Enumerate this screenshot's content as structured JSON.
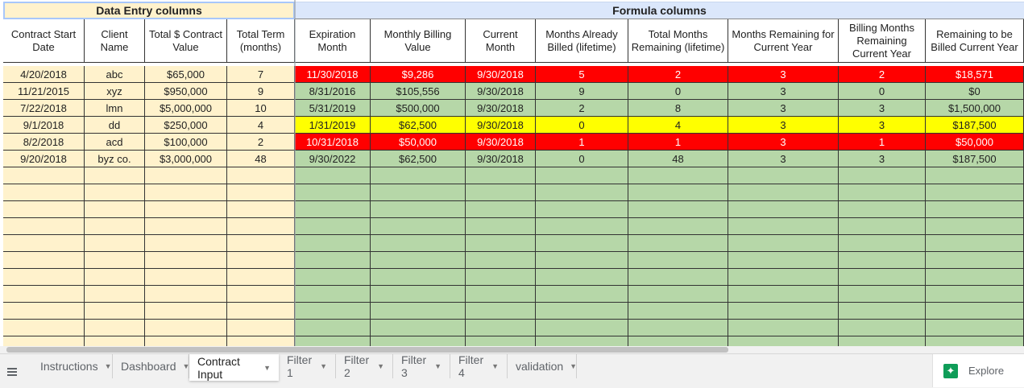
{
  "section_headers": {
    "data_entry": "Data Entry columns",
    "formula": "Formula columns"
  },
  "column_headers": [
    "Contract Start Date",
    "Client Name",
    "Total $ Contract Value",
    "Total Term (months)",
    "Expiration Month",
    "Monthly Billing Value",
    "Current Month",
    "Months Already Billed (lifetime)",
    "Total Months Remaining (lifetime)",
    "Months Remaining for Current Year",
    "Billing Months Remaining Current Year",
    "Remaining to be Billed Current Year"
  ],
  "rows": [
    {
      "highlight": "red",
      "cells": [
        "4/20/2018",
        "abc",
        "$65,000",
        "7",
        "11/30/2018",
        "$9,286",
        "9/30/2018",
        "5",
        "2",
        "3",
        "2",
        "$18,571"
      ]
    },
    {
      "highlight": "none",
      "cells": [
        "11/21/2015",
        "xyz",
        "$950,000",
        "9",
        "8/31/2016",
        "$105,556",
        "9/30/2018",
        "9",
        "0",
        "3",
        "0",
        "$0"
      ]
    },
    {
      "highlight": "none",
      "cells": [
        "7/22/2018",
        "lmn",
        "$5,000,000",
        "10",
        "5/31/2019",
        "$500,000",
        "9/30/2018",
        "2",
        "8",
        "3",
        "3",
        "$1,500,000"
      ]
    },
    {
      "highlight": "yellow",
      "cells": [
        "9/1/2018",
        "dd",
        "$250,000",
        "4",
        "1/31/2019",
        "$62,500",
        "9/30/2018",
        "0",
        "4",
        "3",
        "3",
        "$187,500"
      ]
    },
    {
      "highlight": "red",
      "cells": [
        "8/2/2018",
        "acd",
        "$100,000",
        "2",
        "10/31/2018",
        "$50,000",
        "9/30/2018",
        "1",
        "1",
        "3",
        "1",
        "$50,000"
      ]
    },
    {
      "highlight": "none",
      "cells": [
        "9/20/2018",
        "byz co.",
        "$3,000,000",
        "48",
        "9/30/2022",
        "$62,500",
        "9/30/2018",
        "0",
        "48",
        "3",
        "3",
        "$187,500"
      ]
    }
  ],
  "sheet_tabs": [
    {
      "label": "Instructions",
      "active": false
    },
    {
      "label": "Dashboard",
      "active": false
    },
    {
      "label": "Contract Input",
      "active": true
    },
    {
      "label": "Filter 1",
      "active": false
    },
    {
      "label": "Filter 2",
      "active": false
    },
    {
      "label": "Filter 3",
      "active": false
    },
    {
      "label": "Filter 4",
      "active": false
    },
    {
      "label": "validation",
      "active": false
    }
  ],
  "explore_label": "Explore",
  "colors": {
    "data_entry_bg": "#fff2cc",
    "formula_bg": "#b6d7a8",
    "highlight_red": "#ff0000",
    "highlight_yellow": "#ffff00",
    "explore_icon": "#0f9d58"
  },
  "icons": {
    "all_sheets": "all-sheets-icon",
    "explore": "explore-icon",
    "tab_dropdown": "chevron-down-icon"
  }
}
